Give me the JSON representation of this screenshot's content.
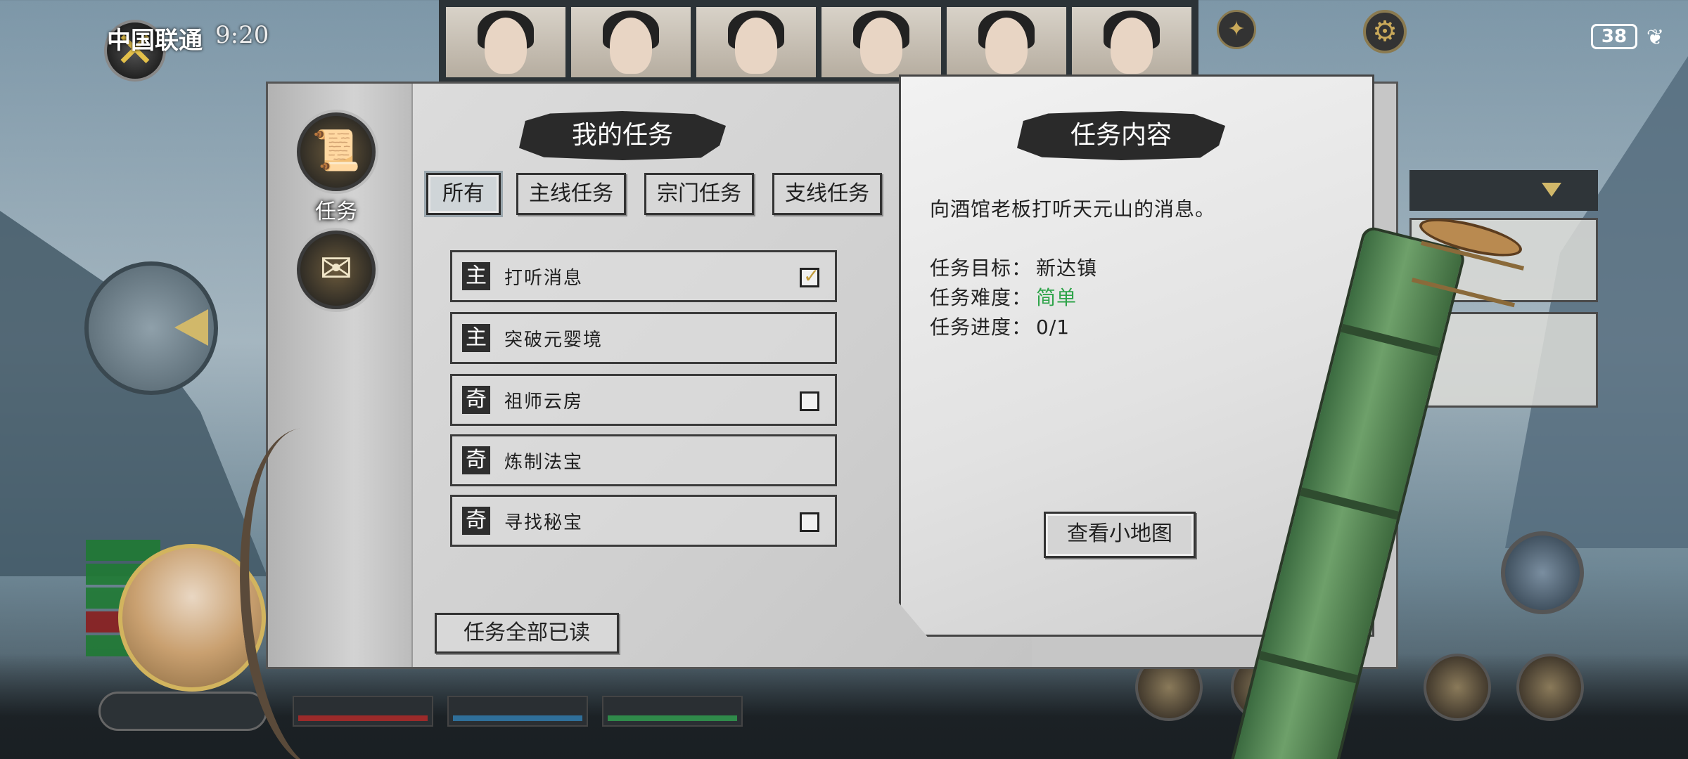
{
  "status": {
    "carrier": "中国联通",
    "time": "9:20",
    "battery": "38"
  },
  "left_page": {
    "title": "我的任务",
    "category_label": "任务",
    "tabs": [
      {
        "label": "所有",
        "active": true
      },
      {
        "label": "主线任务",
        "active": false
      },
      {
        "label": "宗门任务",
        "active": false
      },
      {
        "label": "支线任务",
        "active": false
      }
    ],
    "quests": [
      {
        "badge": "主",
        "name": "打听消息",
        "checkbox": true,
        "checked": true
      },
      {
        "badge": "主",
        "name": "突破元婴境",
        "checkbox": false,
        "checked": false
      },
      {
        "badge": "奇",
        "name": "祖师云房",
        "checkbox": true,
        "checked": false
      },
      {
        "badge": "奇",
        "name": "炼制法宝",
        "checkbox": false,
        "checked": false
      },
      {
        "badge": "奇",
        "name": "寻找秘宝",
        "checkbox": true,
        "checked": false
      }
    ],
    "read_all_label": "任务全部已读"
  },
  "right_page": {
    "title": "任务内容",
    "description": "向酒馆老板打听天元山的消息。",
    "target_label": "任务目标：",
    "target_value": "新达镇",
    "difficulty_label": "任务难度：",
    "difficulty_value": "简单",
    "progress_label": "任务进度：",
    "progress_value": "0/1",
    "minimap_button": "查看小地图"
  },
  "colors": {
    "difficulty_easy": "#2fa44a",
    "accent_gold": "#c29b3a"
  }
}
